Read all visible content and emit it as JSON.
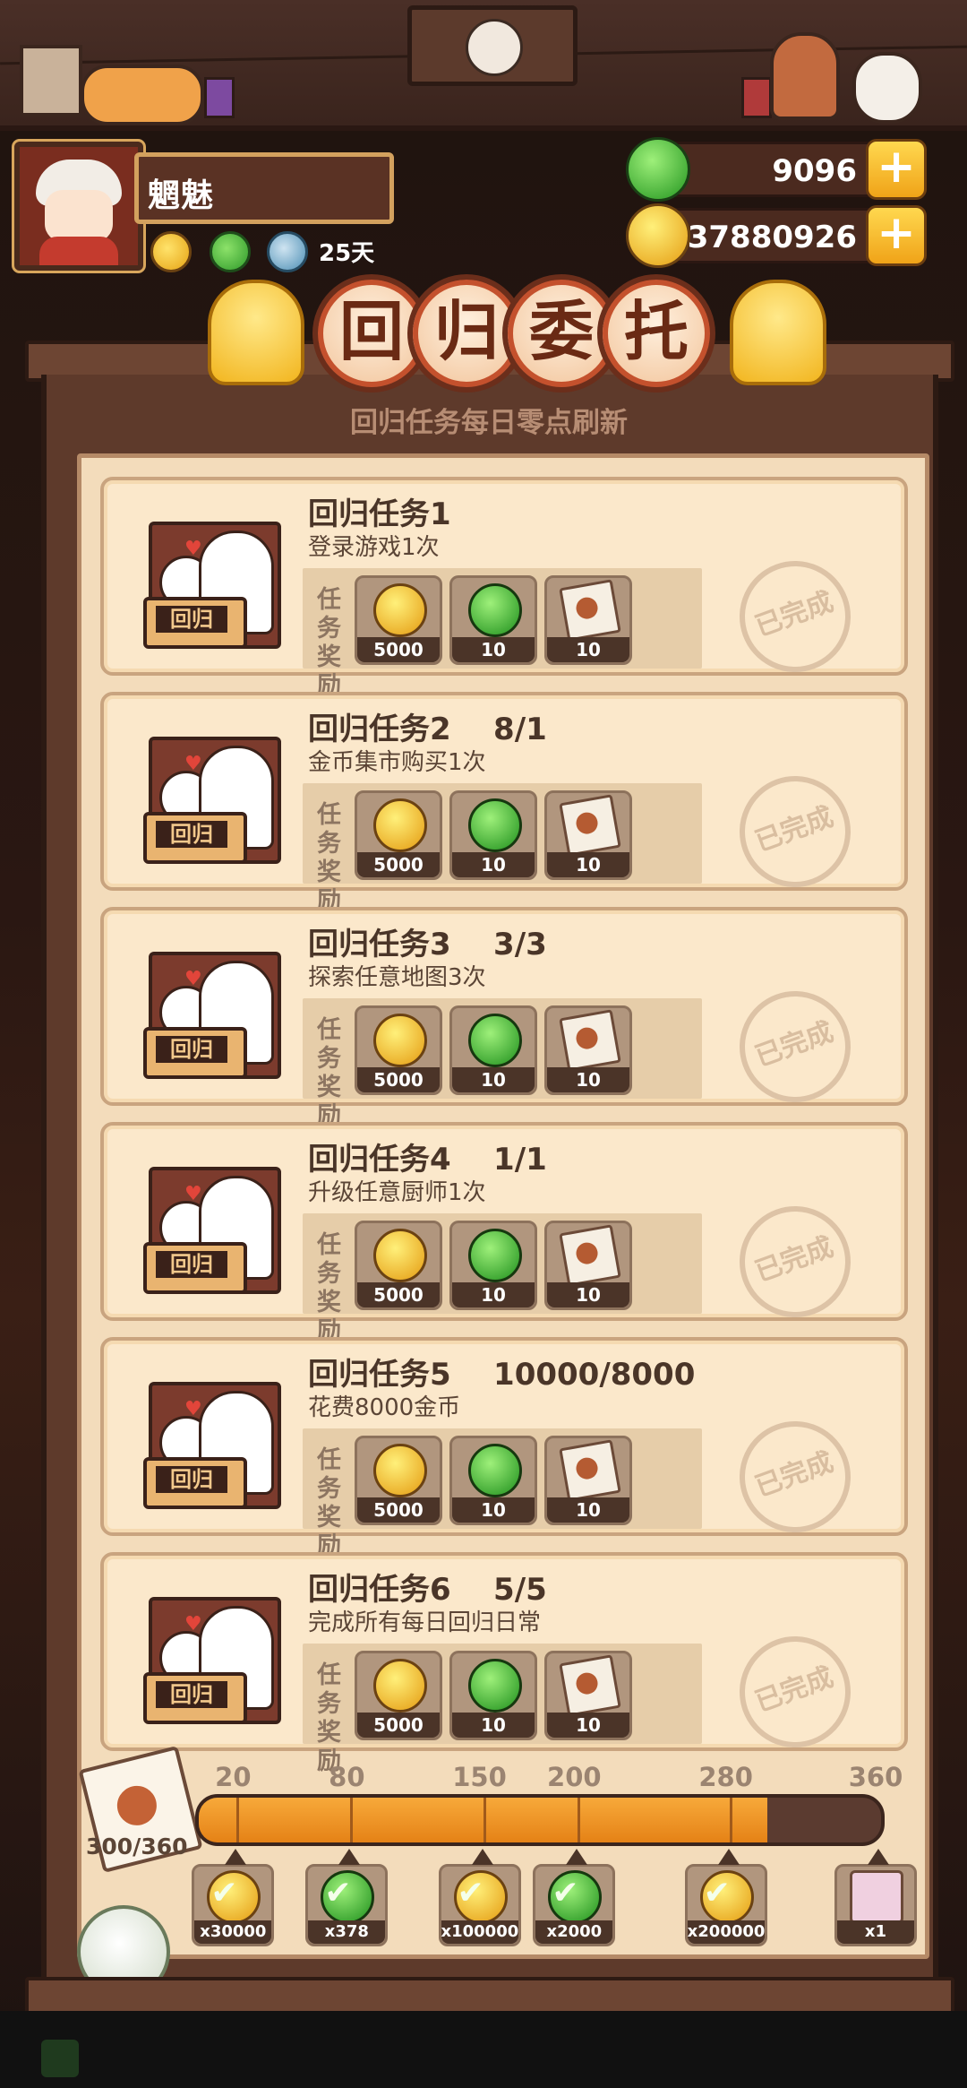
{
  "player": {
    "name": "魍魅",
    "days": "25天"
  },
  "resources": {
    "green_apples": "9096",
    "gold_coins": "37880926"
  },
  "header": {
    "title_chars": [
      "回",
      "归",
      "委",
      "托"
    ],
    "subtitle": "回归任务每日零点刷新"
  },
  "tasks": [
    {
      "title": "回归任务1",
      "progress": "",
      "desc": "登录游戏1次"
    },
    {
      "title": "回归任务2",
      "progress": "8/1",
      "desc": "金币集市购买1次"
    },
    {
      "title": "回归任务3",
      "progress": "3/3",
      "desc": "探索任意地图3次"
    },
    {
      "title": "回归任务4",
      "progress": "1/1",
      "desc": "升级任意厨师1次"
    },
    {
      "title": "回归任务5",
      "progress": "10000/8000",
      "desc": "花费8000金币"
    },
    {
      "title": "回归任务6",
      "progress": "5/5",
      "desc": "完成所有每日回归日常"
    }
  ],
  "task_common": {
    "thumb_label": "回归",
    "reward_label": "任务奖励",
    "reward_coin": "5000",
    "reward_apple": "10",
    "reward_card": "10",
    "status": "已完成"
  },
  "progress": {
    "count": "300/360",
    "current": 300,
    "max": 360,
    "milestones": [
      {
        "point": "20",
        "reward": "x30000",
        "type": "coin",
        "claimed": true
      },
      {
        "point": "80",
        "reward": "x378",
        "type": "apple",
        "claimed": true
      },
      {
        "point": "150",
        "reward": "x100000",
        "type": "coin",
        "claimed": true
      },
      {
        "point": "200",
        "reward": "x2000",
        "type": "apple",
        "claimed": true
      },
      {
        "point": "280",
        "reward": "x200000",
        "type": "coin",
        "claimed": true
      },
      {
        "point": "360",
        "reward": "x1",
        "type": "card",
        "claimed": false
      }
    ]
  },
  "colors": {
    "accent_orange": "#e58216",
    "panel_brown": "#5e3a2b",
    "card_cream": "#fbe8cb"
  }
}
